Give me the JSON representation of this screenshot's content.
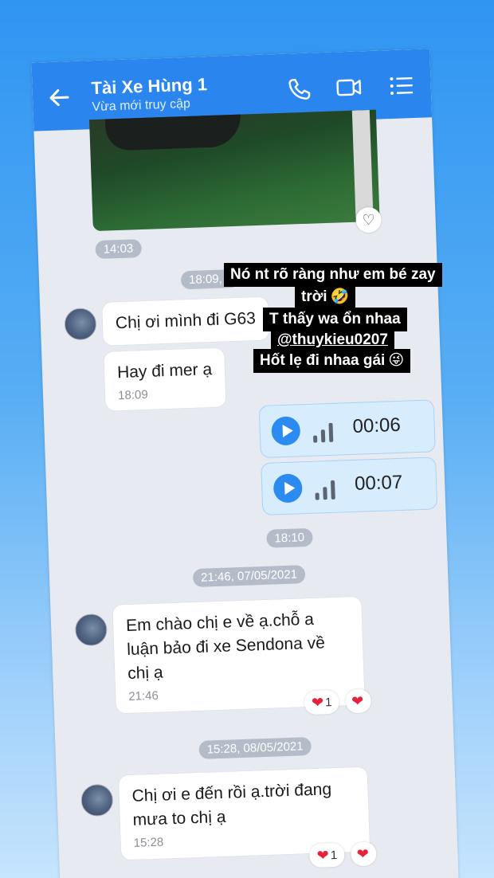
{
  "header": {
    "title": "Tài Xe Hùng 1",
    "status": "Vừa mới truy cập",
    "icons": [
      "back-arrow-icon",
      "phone-icon",
      "video-call-icon",
      "menu-list-icon"
    ]
  },
  "messages": {
    "photo_time": "14:03",
    "ts1": "18:09, 0",
    "msg1": "Chị ơi mình đi G63",
    "msg2": "Hay đi mer ạ",
    "msg2_time": "18:09",
    "voice1": "00:06",
    "voice2": "00:07",
    "voice_time": "18:10",
    "ts2": "21:46, 07/05/2021",
    "msg3": "Em chào chị e về ạ.chỗ a luận bảo đi xe Sendona về chị ạ",
    "msg3_time": "21:46",
    "react_count1": "1",
    "ts3": "15:28, 08/05/2021",
    "msg4": "Chị ơi e đến rồi ạ.trời đang mưa to chị ạ",
    "msg4_time": "15:28",
    "react_count2": "1"
  },
  "overlay": {
    "line1": "Nó nt rõ ràng như em bé zay",
    "line2": "trời",
    "line2_emoji": "🤣",
    "line3": "T thấy wa ổn nhaa",
    "line4": "@thuykieu0207",
    "line5": "Hốt lẹ đi nhaa gái",
    "line5_emoji": "😜"
  },
  "colors": {
    "header": "#2a86ee",
    "chat_bg": "#e7ebf1",
    "voice_bg": "#d7ecfd",
    "accent": "#2b8bf0",
    "heart": "#e5223a"
  }
}
